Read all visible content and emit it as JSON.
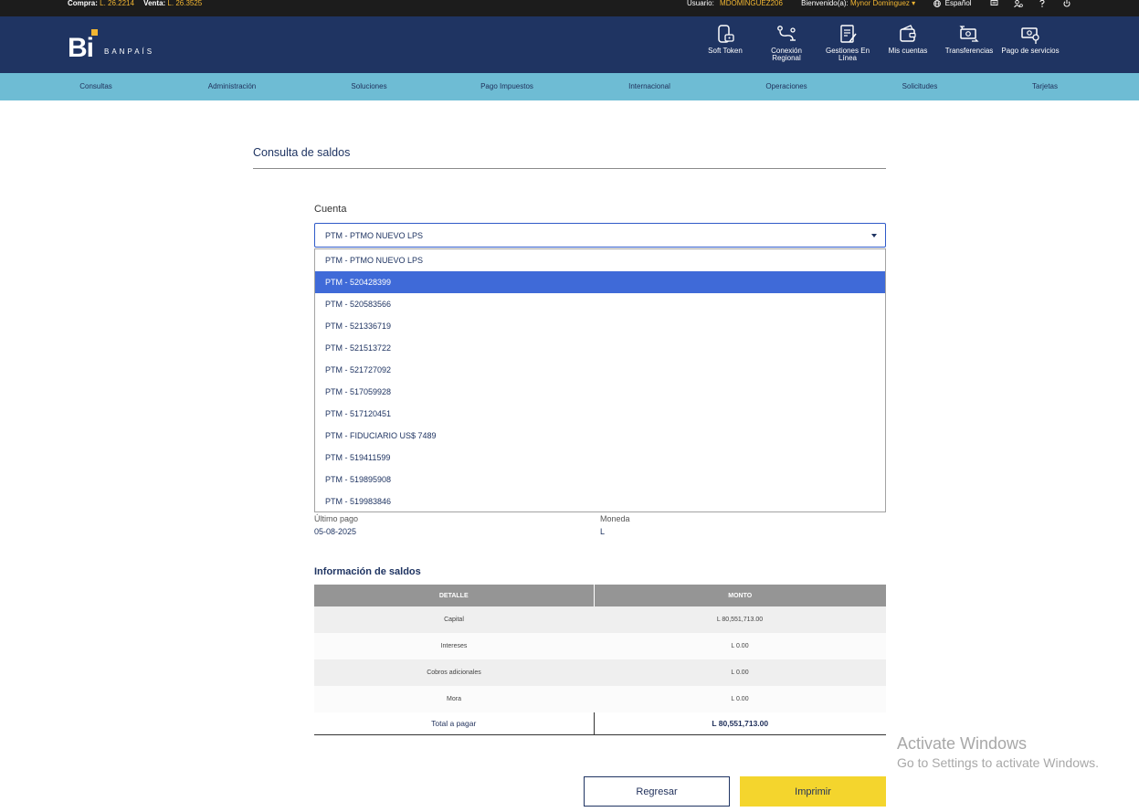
{
  "topbar": {
    "compra_label": "Compra:",
    "compra_value": "L. 26.2214",
    "venta_label": "Venta:",
    "venta_value": "L. 26.3525",
    "usuario_label": "Usuario:",
    "usuario_value": "MDOMINGUEZ206",
    "bienvenido_label": "Bienvenido(a):",
    "bienvenido_value": "Mynor Dominguez",
    "language": "Español"
  },
  "header": {
    "logo_text": "Bi",
    "brand": "BANPAÍS",
    "nav": [
      {
        "label": "Soft Token",
        "icon": "phone-token-icon"
      },
      {
        "label": "Conexión Regional",
        "icon": "route-icon"
      },
      {
        "label": "Gestiones En Línea",
        "icon": "document-edit-icon"
      },
      {
        "label": "Mis cuentas",
        "icon": "wallet-icon"
      },
      {
        "label": "Transferencias",
        "icon": "money-transfer-icon"
      },
      {
        "label": "Pago de servicios",
        "icon": "bill-payment-icon"
      }
    ]
  },
  "menu": [
    "Consultas",
    "Administración",
    "Soluciones",
    "Pago Impuestos",
    "Internacional",
    "Operaciones",
    "Solicitudes",
    "Tarjetas"
  ],
  "page": {
    "title": "Consulta de saldos",
    "field_label": "Cuenta",
    "selected_account": "PTM - PTMO NUEVO LPS",
    "options": [
      "PTM - PTMO NUEVO LPS",
      "PTM - 520428399",
      "PTM - 520583566",
      "PTM - 521336719",
      "PTM - 521513722",
      "PTM - 521727092",
      "PTM - 517059928",
      "PTM - 517120451",
      "PTM - FIDUCIARIO US$ 7489",
      "PTM - 519411599",
      "PTM - 519895908",
      "PTM - 519983846"
    ],
    "highlighted_option_index": 1,
    "ultimo_pago_label": "Último pago",
    "ultimo_pago_value": "05-08-2025",
    "moneda_label": "Moneda",
    "moneda_value": "L",
    "section_title": "Información de saldos",
    "table": {
      "headers": [
        "DETALLE",
        "MONTO"
      ],
      "rows": [
        [
          "Capital",
          "L 80,551,713.00"
        ],
        [
          "Intereses",
          "L 0.00"
        ],
        [
          "Cobros adicionales",
          "L 0.00"
        ],
        [
          "Mora",
          "L 0.00"
        ]
      ],
      "total_label": "Total a pagar",
      "total_value": "L 80,551,713.00"
    },
    "buttons": {
      "back": "Regresar",
      "print": "Imprimir"
    }
  },
  "watermark": {
    "line1": "Activate Windows",
    "line2": "Go to Settings to activate Windows."
  },
  "colors": {
    "header_bg": "#1f3462",
    "menu_bg": "#6ebcd4",
    "accent": "#f2b632",
    "selected_option": "#3f6ad8",
    "print_button": "#f4d52d"
  }
}
